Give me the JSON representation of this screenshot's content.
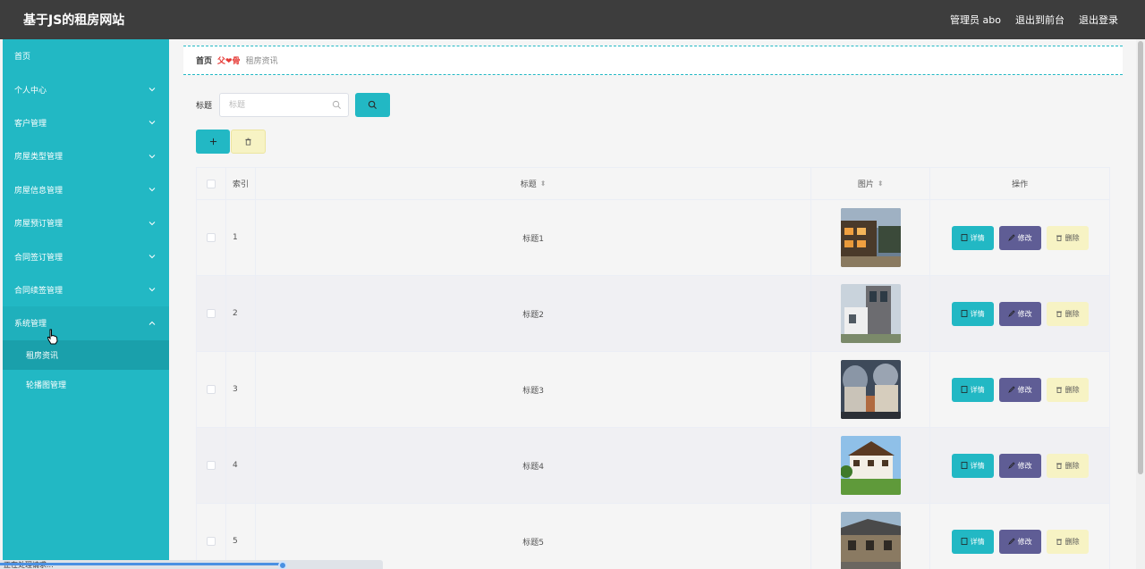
{
  "header": {
    "title": "基于JS的租房网站",
    "admin_label": "管理员 abo",
    "to_front_label": "退出到前台",
    "logout_label": "退出登录"
  },
  "sidebar": {
    "items": [
      {
        "label": "首页"
      },
      {
        "label": "个人中心"
      },
      {
        "label": "客户管理"
      },
      {
        "label": "房屋类型管理"
      },
      {
        "label": "房屋信息管理"
      },
      {
        "label": "房屋预订管理"
      },
      {
        "label": "合同签订管理"
      },
      {
        "label": "合同续签管理"
      },
      {
        "label": "系统管理"
      }
    ],
    "sub_items": [
      {
        "label": "租房资讯"
      },
      {
        "label": "轮播图管理"
      }
    ]
  },
  "breadcrumb": {
    "home": "首页",
    "separator": "父❤骨",
    "current": "租房资讯"
  },
  "search": {
    "label": "标题",
    "placeholder": "标题"
  },
  "table": {
    "headers": {
      "index": "索引",
      "title": "标题",
      "image": "图片",
      "actions": "操作"
    },
    "rows": [
      {
        "index": "1",
        "title": "标题1",
        "image": "photo-1"
      },
      {
        "index": "2",
        "title": "标题2",
        "image": "photo-2"
      },
      {
        "index": "3",
        "title": "标题3",
        "image": "photo-3"
      },
      {
        "index": "4",
        "title": "标题4",
        "image": "photo-4"
      },
      {
        "index": "5",
        "title": "标题5",
        "image": "photo-5"
      }
    ],
    "actions": {
      "detail": "详情",
      "edit": "修改",
      "delete": "删除"
    }
  },
  "status": {
    "text": "正在处理请求..."
  },
  "colors": {
    "accent": "#22b8c4",
    "header_bg": "#3d3d3d",
    "edit_button": "#5f5d95",
    "delete_button": "#f7f3c4"
  }
}
